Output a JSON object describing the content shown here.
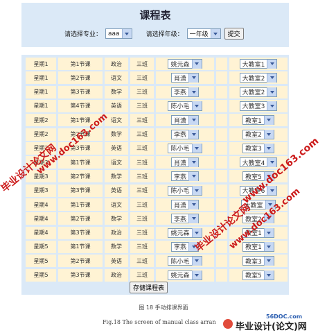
{
  "header": {
    "title": "课程表",
    "major_label": "请选择专业：",
    "major_value": "aaa",
    "grade_label": "请选择年级：",
    "grade_value": "一年级",
    "submit_label": "提交"
  },
  "rows": [
    {
      "day": "星期1",
      "period": "第1节课",
      "subject": "政治",
      "cls": "三班",
      "teacher": "姚元森",
      "room": "大教室1"
    },
    {
      "day": "星期1",
      "period": "第2节课",
      "subject": "语文",
      "cls": "三班",
      "teacher": "肖潇",
      "room": "大教室2"
    },
    {
      "day": "星期1",
      "period": "第3节课",
      "subject": "数学",
      "cls": "三班",
      "teacher": "李燕",
      "room": "大教室2"
    },
    {
      "day": "星期1",
      "period": "第4节课",
      "subject": "英语",
      "cls": "三班",
      "teacher": "陈小毛",
      "room": "大教室3"
    },
    {
      "day": "星期2",
      "period": "第1节课",
      "subject": "语文",
      "cls": "三班",
      "teacher": "肖潇",
      "room": "教室1"
    },
    {
      "day": "星期2",
      "period": "第2节课",
      "subject": "数学",
      "cls": "三班",
      "teacher": "李燕",
      "room": "教室2"
    },
    {
      "day": "星期2",
      "period": "第3节课",
      "subject": "英语",
      "cls": "三班",
      "teacher": "陈小毛",
      "room": "教室3"
    },
    {
      "day": "星期3",
      "period": "第1节课",
      "subject": "语文",
      "cls": "三班",
      "teacher": "肖潇",
      "room": "大教室4"
    },
    {
      "day": "星期3",
      "period": "第2节课",
      "subject": "数学",
      "cls": "三班",
      "teacher": "李燕",
      "room": "教室5"
    },
    {
      "day": "星期3",
      "period": "第3节课",
      "subject": "英语",
      "cls": "三班",
      "teacher": "陈小毛",
      "room": "大教室6"
    },
    {
      "day": "星期4",
      "period": "第1节课",
      "subject": "语文",
      "cls": "三班",
      "teacher": "肖潇",
      "room": "大教室"
    },
    {
      "day": "星期4",
      "period": "第2节课",
      "subject": "数学",
      "cls": "三班",
      "teacher": "李燕",
      "room": "教室2"
    },
    {
      "day": "星期4",
      "period": "第3节课",
      "subject": "政治",
      "cls": "三班",
      "teacher": "姚元森",
      "room": "教室1"
    },
    {
      "day": "星期5",
      "period": "第1节课",
      "subject": "数学",
      "cls": "三班",
      "teacher": "李燕",
      "room": "教室1"
    },
    {
      "day": "星期5",
      "period": "第2节课",
      "subject": "英语",
      "cls": "三班",
      "teacher": "陈小毛",
      "room": "教室3"
    },
    {
      "day": "星期5",
      "period": "第3节课",
      "subject": "政治",
      "cls": "三班",
      "teacher": "姚元森",
      "room": "教室5"
    }
  ],
  "save_label": "存储课程表",
  "caption_cn": "图 18   手动排课界面",
  "caption_en": "Fig.18 The screen of manual class arran",
  "watermarks": {
    "wm1": "毕业设计论文网",
    "wm2": "www.doc163.com",
    "wm3": "www.doc163.com",
    "wm4": "毕业设计论文网",
    "wm5": "www.doc163.com"
  },
  "logo": {
    "site": "56DOC.com",
    "name": "毕业设计(论文)网"
  }
}
